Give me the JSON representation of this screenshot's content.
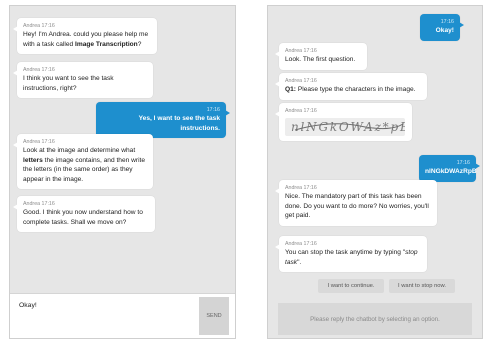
{
  "left": {
    "messages": [
      {
        "meta": "Andrea 17:16",
        "before": "Hey! I'm Andrea. could you please help me with a task called ",
        "bold": "Image Transcription",
        "after": "?"
      },
      {
        "meta": "Andrea 17:16",
        "text": "I think you want to see the task instructions, right?"
      },
      {
        "meta": "17:16",
        "text": "Yes, I want to see the task instructions."
      },
      {
        "meta": "Andrea 17:16",
        "before": "Look at the image and determine what ",
        "bold": "letters",
        "after": " the image contains, and then write the letters (in the same order) as they appear in the image."
      },
      {
        "meta": "Andrea 17:16",
        "text": "Good. I think you now understand how to complete tasks. Shall we move on?"
      }
    ],
    "input_value": "Okay!",
    "send_label": "SEND"
  },
  "right": {
    "messages": [
      {
        "meta": "17:16",
        "text": "Okay!"
      },
      {
        "meta": "Andrea 17:16",
        "text": "Look. The first question."
      },
      {
        "meta": "Andrea 17:16",
        "bold": "Q1:",
        "after": " Please type the characters in the image."
      },
      {
        "meta": "Andrea 17:16",
        "captcha": "nlNGkOWAz*pB"
      },
      {
        "meta": "17:16",
        "text": "nlNGkDWAzRpB"
      },
      {
        "meta": "Andrea 17:16",
        "text": "Nice. The mandatory part of this task has been done. Do you want to do more? No worries, you'll get paid."
      },
      {
        "meta": "Andrea 17:16",
        "before": "You can stop the task anytime by typing \"",
        "italic": "stop task",
        "after": "\"."
      }
    ],
    "options": [
      "I want to continue.",
      "I want to stop now."
    ],
    "bottom_prompt": "Please reply the chatbot by selecting an option."
  },
  "colors": {
    "user_bubble": "#1e8fce",
    "panel_bg": "#e6e6e6"
  }
}
